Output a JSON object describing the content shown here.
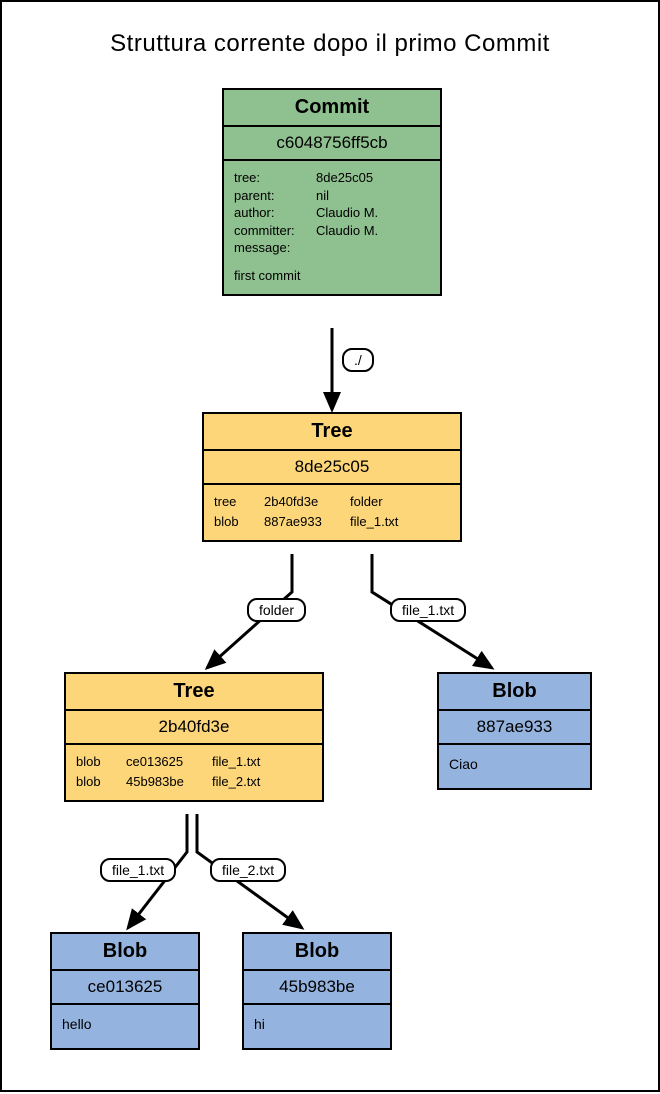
{
  "title": "Struttura corrente dopo il primo Commit",
  "commit": {
    "label": "Commit",
    "hash": "c6048756ff5cb",
    "fields": {
      "tree_key": "tree:",
      "tree_val": "8de25c05",
      "parent_key": "parent:",
      "parent_val": "nil",
      "author_key": "author:",
      "author_val": "Claudio M.",
      "committer_key": "committer:",
      "committer_val": "Claudio M.",
      "message_key": "message:",
      "message_body": "first commit"
    }
  },
  "root_tree": {
    "label": "Tree",
    "hash": "8de25c05",
    "rows": [
      {
        "type": "tree",
        "hash": "2b40fd3e",
        "name": "folder"
      },
      {
        "type": "blob",
        "hash": "887ae933",
        "name": "file_1.txt"
      }
    ]
  },
  "sub_tree": {
    "label": "Tree",
    "hash": "2b40fd3e",
    "rows": [
      {
        "type": "blob",
        "hash": "ce013625",
        "name": "file_1.txt"
      },
      {
        "type": "blob",
        "hash": "45b983be",
        "name": "file_2.txt"
      }
    ]
  },
  "blob_ciao": {
    "label": "Blob",
    "hash": "887ae933",
    "content": "Ciao"
  },
  "blob_hello": {
    "label": "Blob",
    "hash": "ce013625",
    "content": "hello"
  },
  "blob_hi": {
    "label": "Blob",
    "hash": "45b983be",
    "content": "hi"
  },
  "edges": {
    "root": "./",
    "folder": "folder",
    "file1_root": "file_1.txt",
    "file1": "file_1.txt",
    "file2": "file_2.txt"
  }
}
